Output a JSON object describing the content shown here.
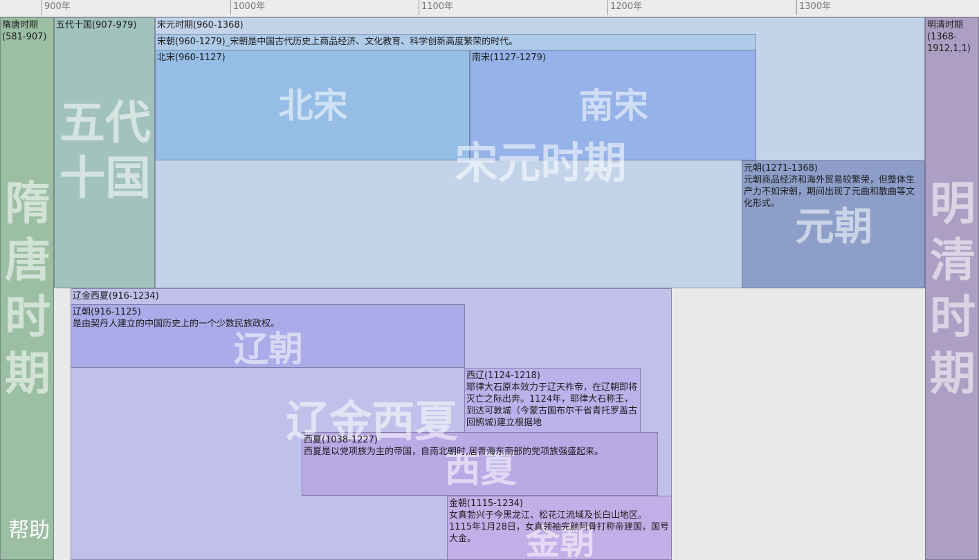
{
  "ruler": {
    "ticks": [
      "900年",
      "1000年",
      "1100年",
      "1200年",
      "1300年"
    ]
  },
  "periods": {
    "suitang": {
      "label": "隋唐时期(581-907)",
      "watermark": "隋唐时期"
    },
    "wudai": {
      "label": "五代十国(907-979)",
      "watermark": "五代十国"
    },
    "songyuan": {
      "label": "宋元时期(960-1368)",
      "watermark": "宋元时期"
    },
    "songchao": {
      "label": "宋朝(960-1279)_宋朝是中国古代历史上商品经济、文化教育、科学创新高度繁荣的时代。"
    },
    "beisong": {
      "label": "北宋(960-1127)",
      "watermark": "北宋"
    },
    "nansong": {
      "label": "南宋(1127-1279)",
      "watermark": "南宋"
    },
    "yuan": {
      "label": "元朝(1271-1368)",
      "desc": "元朝商品经济和海外贸易较繁荣，但整体生产力不如宋朝，期间出现了元曲和散曲等文化形式。",
      "watermark": "元朝"
    },
    "mingqing": {
      "label": "明清时期(1368-1912,1,1)",
      "watermark": "明清时期"
    },
    "liaojinxixia": {
      "label": "辽金西夏(916-1234)",
      "watermark": "辽金西夏"
    },
    "liao": {
      "label": "辽朝(916-1125)",
      "desc": "是由契丹人建立的中国历史上的一个少数民族政权。",
      "watermark": "辽朝"
    },
    "xiliao": {
      "label": "西辽(1124-1218)",
      "desc": "耶律大石原本效力于辽天祚帝，在辽朝即将灭亡之际出奔。1124年，耶律大石称王，到达可敦城（今蒙古国布尔干省青托罗盖古回鹘城)建立根据地"
    },
    "xixia": {
      "label": "西夏(1038-1227)",
      "desc": "西夏是以党项族为主的帝国，自南北朝时,居青海东南部的党项族强盛起来。",
      "watermark": "西夏"
    },
    "jin": {
      "label": "金朝(1115-1234)",
      "desc": "女真勃兴于今黑龙江、松花江流域及长白山地区。1115年1月28日，女真领袖完颜阿骨打称帝建国，国号大金。",
      "watermark": "金朝"
    }
  },
  "help_label": "帮助",
  "colors": {
    "suitang": "#9cbfa4",
    "wudai": "#a2c3bd",
    "songyuan": "#c3d4ea",
    "songchao": "#aecbe9",
    "beisong": "#95bde6",
    "nansong": "#95b3e8",
    "yuan": "#8d9fc9",
    "mingqing": "#ad9fc4",
    "liaojinxixia": "#c0c0ea",
    "liao": "#ababe9",
    "xiliao": "#bab2ea",
    "xixia": "#b9aae6",
    "jin": "#c4aee7"
  }
}
